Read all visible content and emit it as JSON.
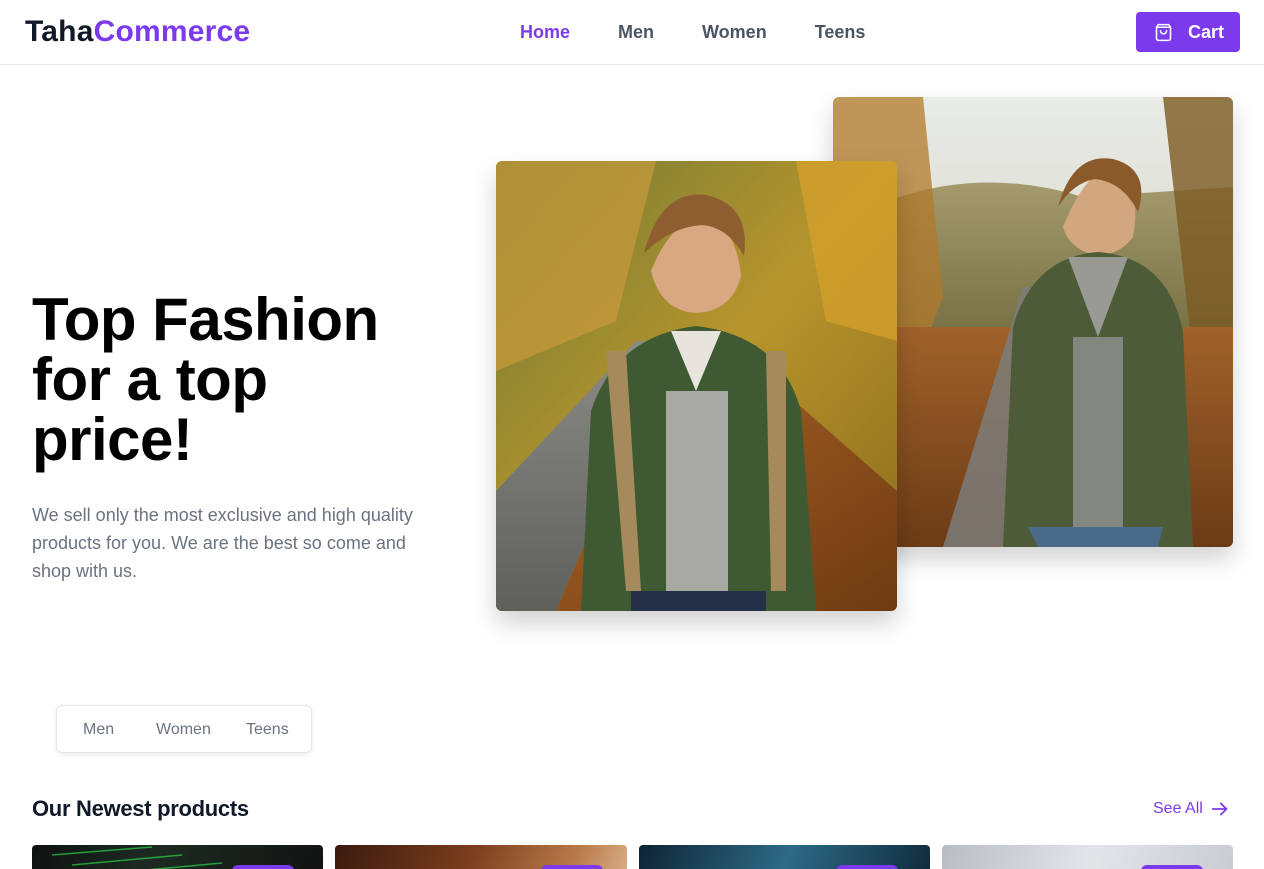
{
  "header": {
    "logo_prefix": "Taha",
    "logo_accent": "Commerce",
    "nav": [
      {
        "label": "Home",
        "active": true
      },
      {
        "label": "Men",
        "active": false
      },
      {
        "label": "Women",
        "active": false
      },
      {
        "label": "Teens",
        "active": false
      }
    ],
    "cart_label": "Cart",
    "cart_icon": "shopping-bag-icon"
  },
  "hero": {
    "title_lines": [
      "Top Fashion",
      "for a top",
      "price!"
    ],
    "description": "We sell only the most exclusive and high quality products for you. We are the best so come and shop with us."
  },
  "filters": [
    "Men",
    "Women",
    "Teens"
  ],
  "products_section": {
    "title": "Our Newest products",
    "see_all_label": "See All",
    "see_all_icon": "arrow-right-icon"
  },
  "colors": {
    "accent": "#7c3aed",
    "text_dark": "#111827",
    "text_muted": "#6b7280"
  }
}
